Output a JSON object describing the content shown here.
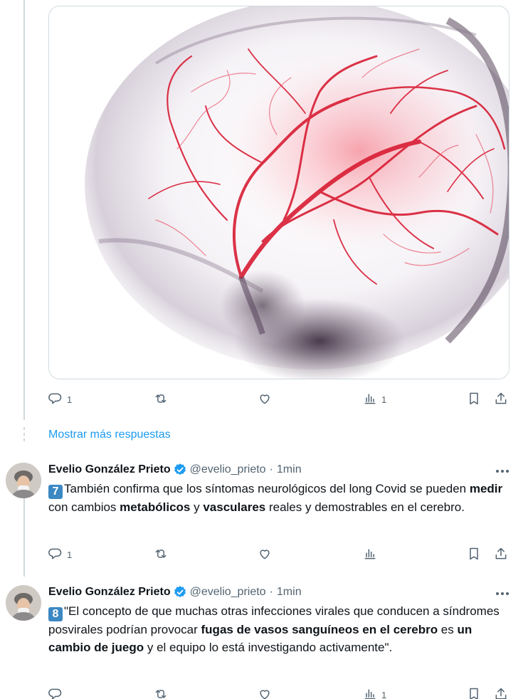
{
  "first_tweet": {
    "image_alt": "",
    "actions": {
      "reply_count": "1",
      "retweet_count": "",
      "like_count": "",
      "views_count": "1"
    }
  },
  "show_more_label": "Mostrar más respuestas",
  "tweets": [
    {
      "name": "Evelio González Prieto",
      "handle": "@evelio_prieto",
      "separator": "·",
      "time": "1min",
      "number_emoji": "7",
      "segments": [
        {
          "t": "También confirma que los síntomas neurológicos del long Covid se pueden ",
          "b": false
        },
        {
          "t": "medir",
          "b": true
        },
        {
          "t": " con cambios ",
          "b": false
        },
        {
          "t": "metabólicos",
          "b": true
        },
        {
          "t": " y ",
          "b": false
        },
        {
          "t": "vasculares",
          "b": true
        },
        {
          "t": " reales y demostrables en el cerebro.",
          "b": false
        }
      ],
      "actions": {
        "reply_count": "1",
        "retweet_count": "",
        "like_count": "",
        "views_count": ""
      }
    },
    {
      "name": "Evelio González Prieto",
      "handle": "@evelio_prieto",
      "separator": "·",
      "time": "1min",
      "number_emoji": "8",
      "segments": [
        {
          "t": "\"El concepto de que muchas otras infecciones virales que conducen a síndromes posvirales podrían provocar ",
          "b": false
        },
        {
          "t": "fugas de vasos sanguíneos en el cerebro",
          "b": true
        },
        {
          "t": " es ",
          "b": false
        },
        {
          "t": "un cambio de juego",
          "b": true
        },
        {
          "t": " y el equipo lo está investigando activamente\".",
          "b": false
        }
      ],
      "actions": {
        "reply_count": "",
        "retweet_count": "",
        "like_count": "",
        "views_count": "1"
      }
    }
  ],
  "colors": {
    "link": "#1d9bf0",
    "muted": "#536471",
    "verified": "#1d9bf0",
    "keycap": "#3b88c3"
  }
}
